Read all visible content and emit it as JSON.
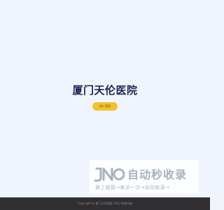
{
  "main": {
    "title": "厦门天伦医院",
    "enter_button_label": "进入官网"
  },
  "watermark": {
    "title": "自动秒收录",
    "tagline": "做上链接→来访一次→自动收录→"
  },
  "footer": {
    "copyright": "Copyright © 厦门天伦医院 2023 版权所有"
  },
  "colors": {
    "background": "#f0f5fd",
    "title": "#1d2550",
    "button": "#f2c230",
    "footer": "#2f2f31",
    "watermark_text": "#a8b2bf"
  }
}
